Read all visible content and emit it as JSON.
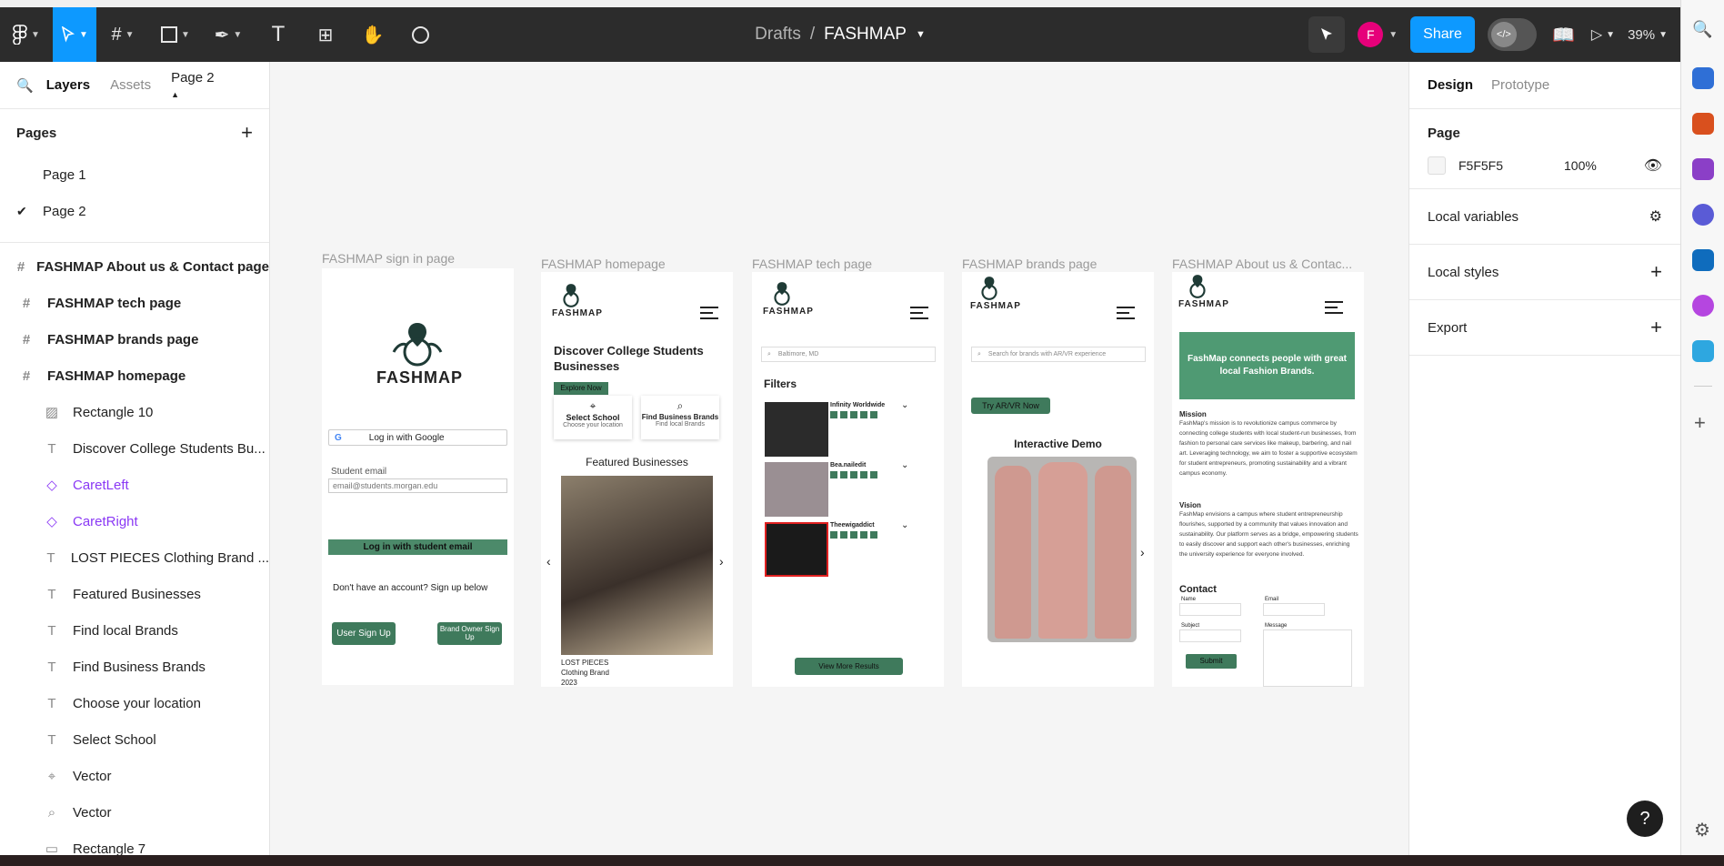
{
  "topbar": {
    "breadcrumb_parent": "Drafts",
    "breadcrumb_sep": "/",
    "file_name": "FASHMAP",
    "avatar_initial": "F",
    "share_label": "Share",
    "zoom": "39%"
  },
  "left_panel": {
    "tabs": [
      "Layers",
      "Assets"
    ],
    "current_page": "Page 2",
    "pages_title": "Pages",
    "pages": [
      "Page 1",
      "Page 2"
    ],
    "layers": [
      {
        "label": "FASHMAP About us & Contact page",
        "kind": "frame"
      },
      {
        "label": "FASHMAP tech page",
        "kind": "frame"
      },
      {
        "label": "FASHMAP brands page",
        "kind": "frame"
      },
      {
        "label": "FASHMAP homepage",
        "kind": "frame"
      },
      {
        "label": "Rectangle 10",
        "kind": "image"
      },
      {
        "label": "Discover College Students Bu...",
        "kind": "text"
      },
      {
        "label": "CaretLeft",
        "kind": "component"
      },
      {
        "label": "CaretRight",
        "kind": "component"
      },
      {
        "label": "LOST PIECES Clothing Brand ...",
        "kind": "text"
      },
      {
        "label": "Featured Businesses",
        "kind": "text"
      },
      {
        "label": "Find local Brands",
        "kind": "text"
      },
      {
        "label": "Find Business Brands",
        "kind": "text"
      },
      {
        "label": "Choose your location",
        "kind": "text"
      },
      {
        "label": "Select School",
        "kind": "text"
      },
      {
        "label": "Vector",
        "kind": "pin"
      },
      {
        "label": "Vector",
        "kind": "search"
      },
      {
        "label": "Rectangle 7",
        "kind": "rect"
      }
    ]
  },
  "right_panel": {
    "tabs": [
      "Design",
      "Prototype"
    ],
    "page_title": "Page",
    "page_color_hex": "F5F5F5",
    "page_opacity": "100%",
    "sections": [
      "Local variables",
      "Local styles",
      "Export"
    ]
  },
  "canvas": {
    "frame_labels": [
      "FASHMAP sign in page",
      "FASHMAP homepage",
      "FASHMAP tech page",
      "FASHMAP brands page",
      "FASHMAP About us & Contac..."
    ],
    "signin": {
      "logo": "FASHMAP",
      "google": "Log in with Google",
      "email_label": "Student email",
      "email_value": "email@students.morgan.edu",
      "login_btn": "Log in with student email",
      "signup_text": "Don't have an account? Sign up below",
      "user_signup": "User Sign Up",
      "brand_signup": "Brand Owner Sign Up"
    },
    "home": {
      "logo": "FASHMAP",
      "heading": "Discover  College Students Businesses",
      "explore": "Explore Now",
      "select_school": "Select  School",
      "choose_location": "Choose your location",
      "find_business": "Find Business Brands",
      "find_local": "Find local Brands",
      "featured": "Featured Businesses",
      "caption_1": "LOST PIECES",
      "caption_2": "Clothing Brand",
      "caption_3": "2023"
    },
    "tech": {
      "logo": "FASHMAP",
      "search": "Baltimore, MD",
      "filters": "Filters",
      "results": [
        "Infinity Worldwide",
        "Bea.nailedit",
        "Theewigaddict"
      ],
      "view_more": "View More Results"
    },
    "brands": {
      "logo": "FASHMAP",
      "search": "Search for brands with AR/VR experience",
      "try": "Try AR/VR Now",
      "demo": "Interactive Demo"
    },
    "about": {
      "logo": "FASHMAP",
      "banner": "FashMap connects people with great local Fashion Brands.",
      "mission_title": "Mission",
      "mission": "FashMap's mission is to revolutionize campus commerce by connecting college students with local student-run businesses, from fashion to personal care services like makeup, barbering, and nail art. Leveraging technology, we aim to foster a supportive ecosystem for student entrepreneurs, promoting sustainability and a vibrant campus economy.",
      "vision_title": "Vision",
      "vision": "FashMap envisions a campus where student entrepreneurship flourishes, supported by a community that values innovation and sustainability. Our platform serves as a bridge, empowering students to easily discover and support each other's businesses, enriching the university experience for everyone involved.",
      "contact": "Contact",
      "name": "Name",
      "email": "Email",
      "subject": "Subject",
      "message": "Message",
      "submit": "Submit"
    }
  },
  "help_label": "?",
  "colors": {
    "accent": "#0d99ff",
    "brand_green": "#3f7a5c",
    "avatar": "#e6007a"
  }
}
